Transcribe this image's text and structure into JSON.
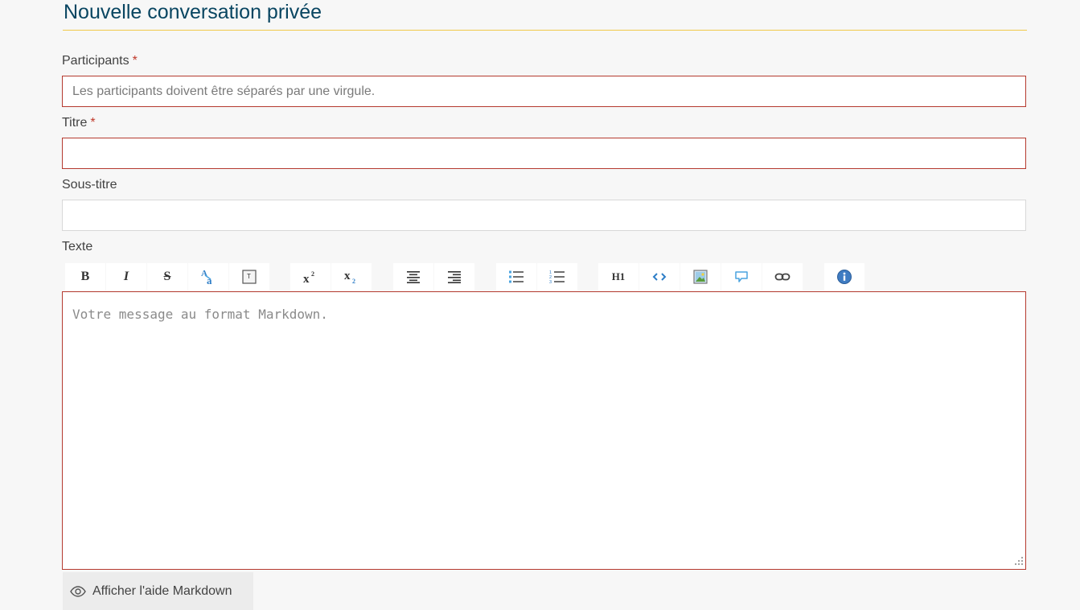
{
  "page": {
    "title": "Nouvelle conversation privée"
  },
  "form": {
    "participants": {
      "label": "Participants",
      "required_mark": "*",
      "placeholder": "Les participants doivent être séparés par une virgule.",
      "value": ""
    },
    "titre": {
      "label": "Titre",
      "required_mark": "*",
      "value": ""
    },
    "sous_titre": {
      "label": "Sous-titre",
      "value": ""
    },
    "texte": {
      "label": "Texte",
      "placeholder": "Votre message au format Markdown.",
      "value": ""
    }
  },
  "toolbar": {
    "buttons": [
      {
        "name": "bold",
        "icon": "bold-icon",
        "glyph": "B"
      },
      {
        "name": "italic",
        "icon": "italic-icon",
        "glyph": "I"
      },
      {
        "name": "strikethrough",
        "icon": "strikethrough-icon",
        "glyph": "S"
      },
      {
        "name": "abbreviation",
        "icon": "abbreviation-icon"
      },
      {
        "name": "keyboard",
        "icon": "keyboard-key-icon"
      },
      {
        "name": "superscript",
        "icon": "superscript-icon"
      },
      {
        "name": "subscript",
        "icon": "subscript-icon"
      },
      {
        "name": "align-center",
        "icon": "align-center-icon"
      },
      {
        "name": "align-right",
        "icon": "align-right-icon"
      },
      {
        "name": "unordered-list",
        "icon": "bullet-list-icon"
      },
      {
        "name": "ordered-list",
        "icon": "numbered-list-icon"
      },
      {
        "name": "heading",
        "icon": "heading-icon",
        "glyph": "H1"
      },
      {
        "name": "code",
        "icon": "code-icon"
      },
      {
        "name": "image",
        "icon": "image-icon"
      },
      {
        "name": "quote",
        "icon": "quote-bubble-icon"
      },
      {
        "name": "link",
        "icon": "link-icon"
      },
      {
        "name": "help",
        "icon": "info-icon"
      }
    ]
  },
  "markdown_help": {
    "label": "Afficher l'aide Markdown",
    "icon": "eye-icon"
  },
  "colors": {
    "title": "#084561",
    "title_rule": "#f0c94a",
    "required": "#c0392b",
    "invalid_border": "#b53a2f",
    "background": "#f7f7f7"
  }
}
